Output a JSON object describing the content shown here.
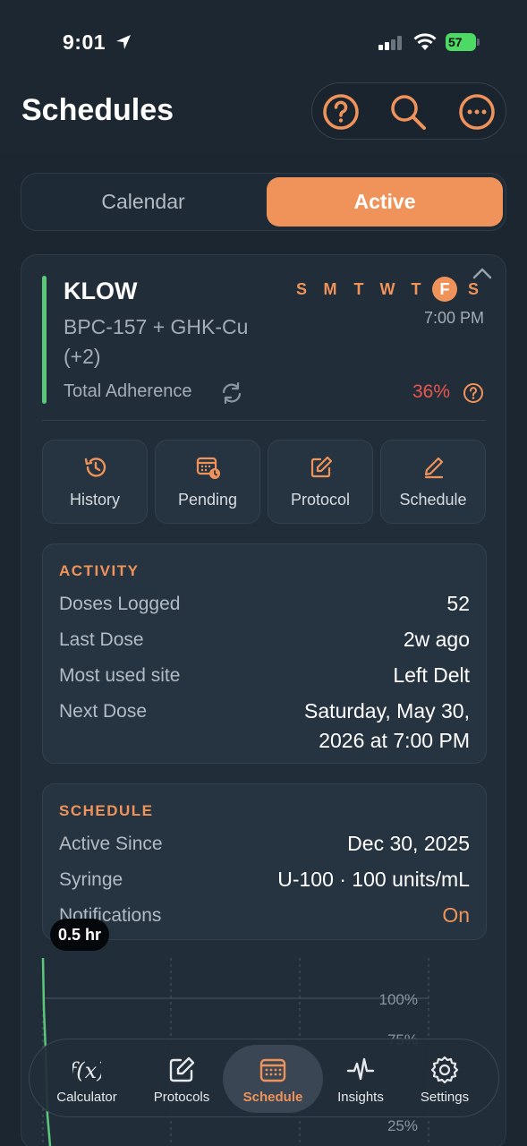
{
  "status": {
    "time": "9:01",
    "battery": "57"
  },
  "header": {
    "title": "Schedules"
  },
  "segments": {
    "calendar": "Calendar",
    "active": "Active"
  },
  "protocol": {
    "name": "KLOW",
    "subtitle": "BPC-157 + GHK-Cu (+2)",
    "days": [
      "S",
      "M",
      "T",
      "W",
      "T",
      "F",
      "S"
    ],
    "active_day": "F",
    "time": "7:00 PM",
    "adherence_label": "Total Adherence",
    "adherence_value": "36%",
    "adherence_color": "#e8574d",
    "accent_color": "#5ac878"
  },
  "actions": {
    "history": "History",
    "pending": "Pending",
    "protocol": "Protocol",
    "schedule": "Schedule"
  },
  "activity": {
    "title": "ACTIVITY",
    "rows": [
      {
        "label": "Doses Logged",
        "value": "52"
      },
      {
        "label": "Last Dose",
        "value": "2w ago"
      },
      {
        "label": "Most used site",
        "value": "Left Delt"
      },
      {
        "label": "Next Dose",
        "value": "Saturday, May 30, 2026 at 7:00 PM"
      }
    ]
  },
  "schedule": {
    "title": "SCHEDULE",
    "rows": [
      {
        "label": "Active Since",
        "value": "Dec 30, 2025"
      },
      {
        "label": "Syringe",
        "value": "U-100 · 100 units/mL"
      },
      {
        "label": "Notifications",
        "value": "On"
      }
    ]
  },
  "chart": {
    "tooltip": "0.5 hr",
    "y_ticks": [
      "100%",
      "75%",
      "25%"
    ]
  },
  "tabbar": [
    {
      "label": "Calculator",
      "icon": "function-icon"
    },
    {
      "label": "Protocols",
      "icon": "edit-square-icon"
    },
    {
      "label": "Schedule",
      "icon": "calendar-grid-icon"
    },
    {
      "label": "Insights",
      "icon": "pulse-icon"
    },
    {
      "label": "Settings",
      "icon": "gear-icon"
    }
  ],
  "colors": {
    "accent": "#f0935a",
    "background": "#1b2631",
    "card": "#212e3a",
    "adherence_low": "#e8574d",
    "protocol_bar": "#5ac878"
  }
}
